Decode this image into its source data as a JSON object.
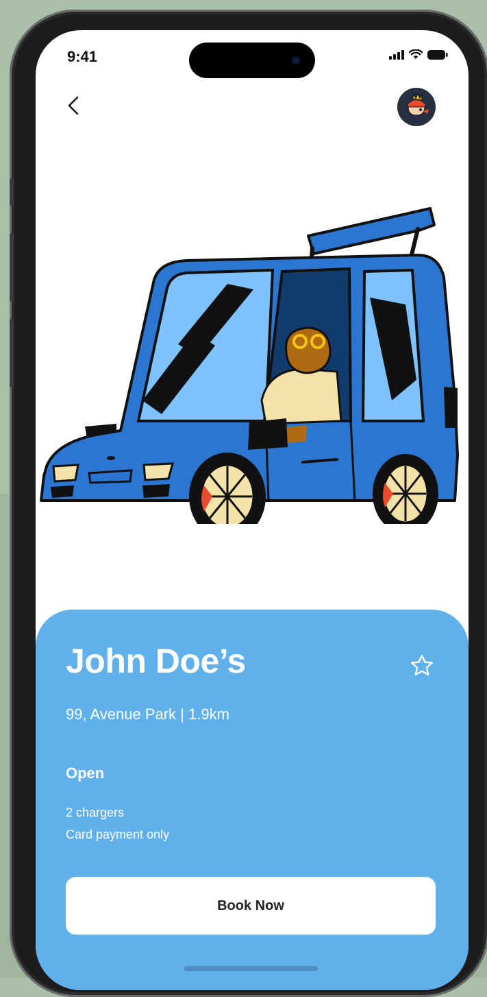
{
  "status_bar": {
    "time": "9:41"
  },
  "icons": {
    "back": "chevron-left-icon",
    "avatar": "character-avatar",
    "favorite": "star-outline-icon",
    "signal": "signal-icon",
    "wifi": "wifi-icon",
    "battery": "battery-icon"
  },
  "station": {
    "name": "John Doe’s",
    "address": "99, Avenue Park | 1.9km",
    "status": "Open",
    "chargers": "2 chargers",
    "payment": "Card payment only"
  },
  "actions": {
    "book_label": "Book Now"
  },
  "colors": {
    "card": "#60b0ec",
    "car_body": "#2a76d2",
    "background": "#a9bfa9"
  }
}
